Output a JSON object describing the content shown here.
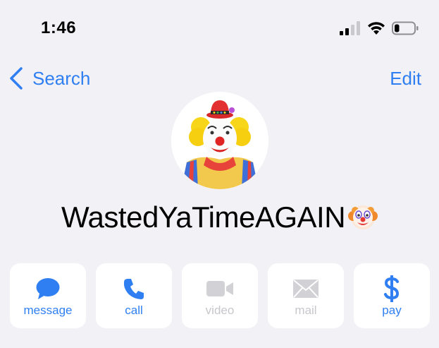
{
  "status_bar": {
    "time": "1:46",
    "icons": [
      "cellular-signal-icon",
      "wifi-icon",
      "battery-icon"
    ],
    "battery_level": 0.25
  },
  "nav": {
    "back_label": "Search",
    "edit_label": "Edit",
    "accent_color": "#2f7ff2"
  },
  "contact": {
    "name": "WastedYaTimeAGAIN",
    "name_emoji": "clown-face-emoji",
    "avatar": "clown-photo"
  },
  "actions": [
    {
      "label": "message",
      "icon": "message-bubble-icon",
      "enabled": true
    },
    {
      "label": "call",
      "icon": "phone-icon",
      "enabled": true
    },
    {
      "label": "video",
      "icon": "video-camera-icon",
      "enabled": false
    },
    {
      "label": "mail",
      "icon": "envelope-icon",
      "enabled": false
    },
    {
      "label": "pay",
      "icon": "dollar-sign-icon",
      "enabled": true
    }
  ],
  "colors": {
    "background": "#f1f1f6",
    "accent": "#2f7ff2",
    "disabled": "#c7c7cc",
    "card": "#ffffff"
  }
}
